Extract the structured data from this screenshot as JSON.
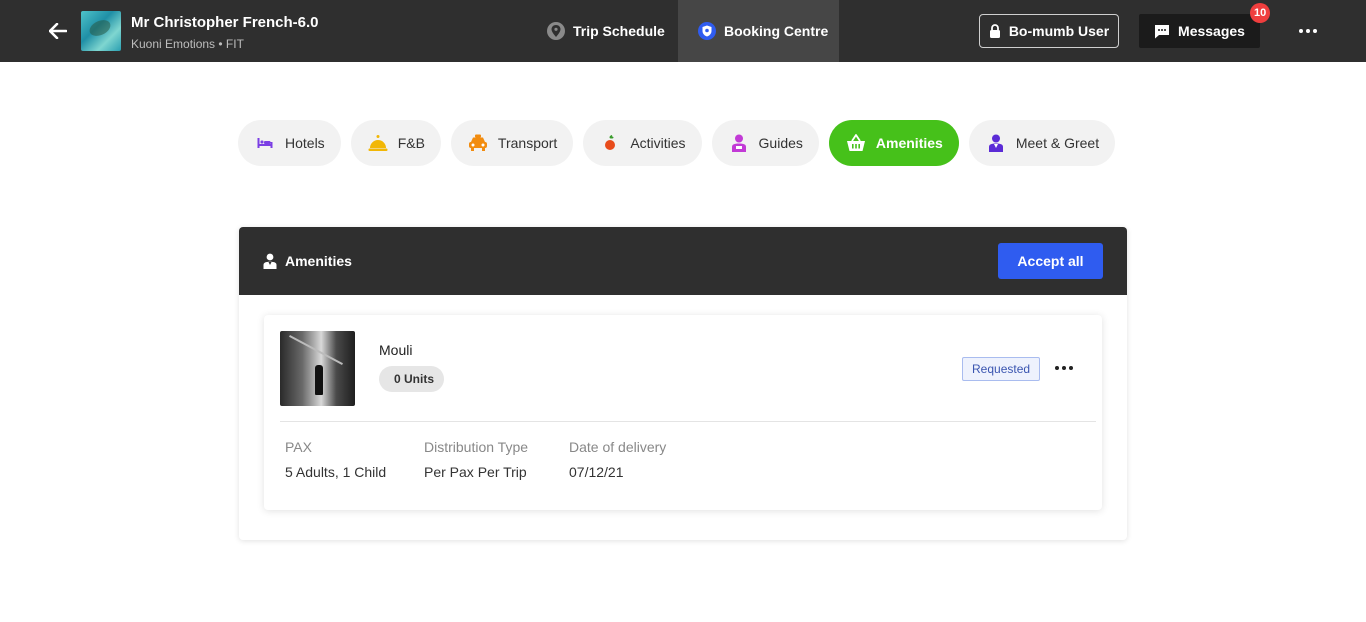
{
  "header": {
    "title": "Mr Christopher French-6.0",
    "subtitle": "Kuoni Emotions • FIT",
    "tabs": [
      {
        "label": "Trip Schedule",
        "icon": "location-pin-icon"
      },
      {
        "label": "Booking Centre",
        "icon": "shield-icon",
        "active": true
      }
    ],
    "user_label": "Bo-mumb User",
    "messages_label": "Messages",
    "messages_count": "10"
  },
  "categories": [
    {
      "label": "Hotels",
      "icon": "bed-icon",
      "color": "#7b3fe4"
    },
    {
      "label": "F&B",
      "icon": "service-bell-icon",
      "color": "#f2b705"
    },
    {
      "label": "Transport",
      "icon": "taxi-icon",
      "color": "#f28c0f"
    },
    {
      "label": "Activities",
      "icon": "fruit-icon",
      "color": "#e84c1c"
    },
    {
      "label": "Guides",
      "icon": "guide-person-icon",
      "color": "#c23ad6"
    },
    {
      "label": "Amenities",
      "icon": "basket-icon",
      "active": true
    },
    {
      "label": "Meet & Greet",
      "icon": "greeter-person-icon",
      "color": "#5b2bd6"
    }
  ],
  "panel": {
    "title": "Amenities",
    "accept_all_label": "Accept all",
    "items": [
      {
        "name": "Mouli",
        "units": "0 Units",
        "status": "Requested",
        "fields": [
          {
            "label": "PAX",
            "value": "5 Adults, 1 Child"
          },
          {
            "label": "Distribution Type",
            "value": "Per Pax Per Trip"
          },
          {
            "label": "Date of delivery",
            "value": "07/12/21"
          }
        ]
      }
    ]
  },
  "colors": {
    "topbar": "#2f2f2f",
    "accent_green": "#46c11a",
    "accent_blue": "#2f5cf0",
    "badge_red": "#f03e3e"
  }
}
